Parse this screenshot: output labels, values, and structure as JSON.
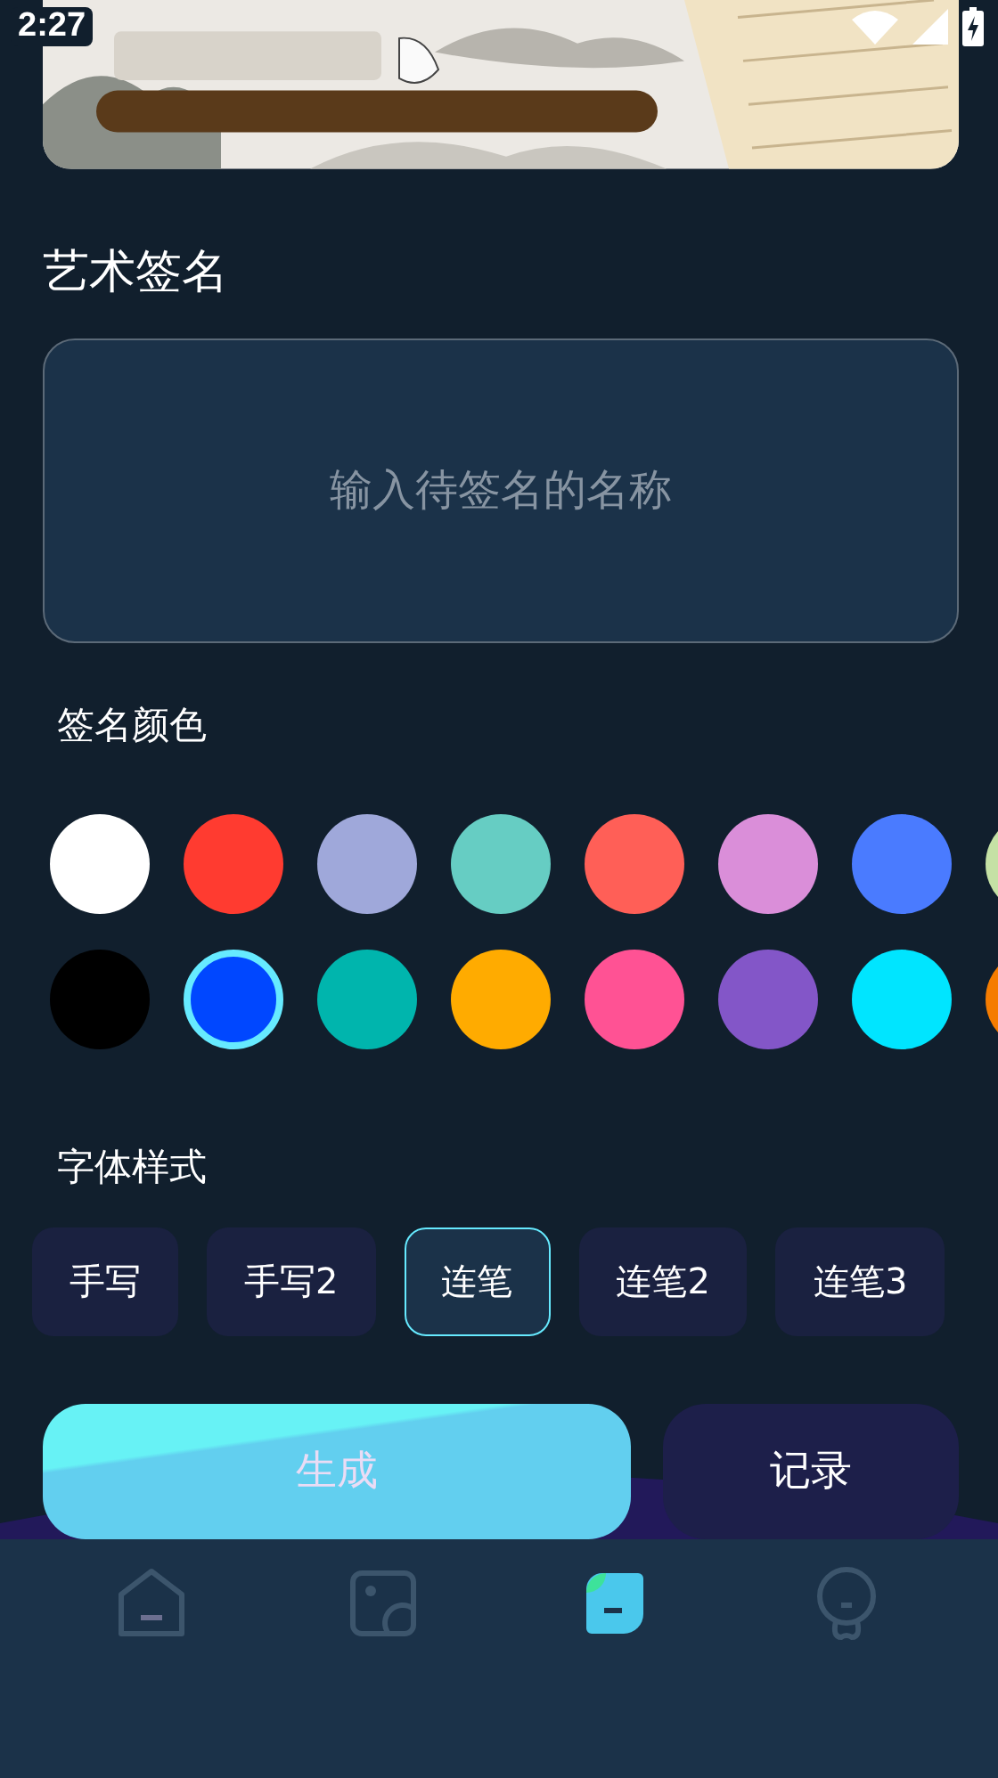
{
  "status_bar": {
    "time": "2:27"
  },
  "section_title": "艺术签名",
  "name_input": {
    "placeholder": "输入待签名的名称"
  },
  "color_label": "签名颜色",
  "colors": [
    {
      "color": "#ffffff",
      "selected": false
    },
    {
      "color": "#ff3b30",
      "selected": false
    },
    {
      "color": "#9fa8da",
      "selected": false
    },
    {
      "color": "#66cdc3",
      "selected": false
    },
    {
      "color": "#ff5f57",
      "selected": false
    },
    {
      "color": "#da8ed9",
      "selected": false
    },
    {
      "color": "#4a7bff",
      "selected": false
    },
    {
      "color": "#c5e1a5",
      "selected": false
    },
    {
      "color": "#000000",
      "selected": false
    },
    {
      "color": "#0047ff",
      "selected": true
    },
    {
      "color": "#00b5ad",
      "selected": false
    },
    {
      "color": "#ffab00",
      "selected": false
    },
    {
      "color": "#ff5294",
      "selected": false
    },
    {
      "color": "#8356c8",
      "selected": false
    },
    {
      "color": "#00e5ff",
      "selected": false
    },
    {
      "color": "#f57c00",
      "selected": false
    }
  ],
  "font_label": "字体样式",
  "font_styles": [
    {
      "label": "手写",
      "selected": false
    },
    {
      "label": "手写2",
      "selected": false
    },
    {
      "label": "连笔",
      "selected": true
    },
    {
      "label": "连笔2",
      "selected": false
    },
    {
      "label": "连笔3",
      "selected": false
    }
  ],
  "actions": [
    {
      "label": "生成",
      "kind": "primary"
    },
    {
      "label": "记录",
      "kind": "secondary"
    }
  ],
  "nav": [
    {
      "kind": "home",
      "selected": false
    },
    {
      "kind": "gallery",
      "selected": false
    },
    {
      "kind": "note",
      "selected": true
    },
    {
      "kind": "profile",
      "selected": false
    }
  ]
}
